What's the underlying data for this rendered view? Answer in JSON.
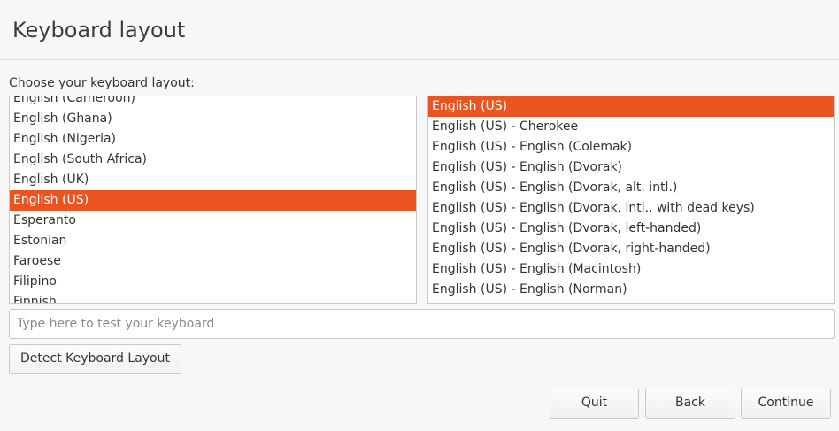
{
  "header": {
    "title": "Keyboard layout"
  },
  "prompt": "Choose your keyboard layout:",
  "layouts": {
    "items": [
      "English (Cameroon)",
      "English (Ghana)",
      "English (Nigeria)",
      "English (South Africa)",
      "English (UK)",
      "English (US)",
      "Esperanto",
      "Estonian",
      "Faroese",
      "Filipino",
      "Finnish"
    ],
    "selected": "English (US)"
  },
  "variants": {
    "items": [
      "English (US)",
      "English (US) - Cherokee",
      "English (US) - English (Colemak)",
      "English (US) - English (Dvorak)",
      "English (US) - English (Dvorak, alt. intl.)",
      "English (US) - English (Dvorak, intl., with dead keys)",
      "English (US) - English (Dvorak, left-handed)",
      "English (US) - English (Dvorak, right-handed)",
      "English (US) - English (Macintosh)",
      "English (US) - English (Norman)"
    ],
    "selected": "English (US)"
  },
  "test_input": {
    "value": "",
    "placeholder": "Type here to test your keyboard"
  },
  "buttons": {
    "detect": "Detect Keyboard Layout",
    "quit": "Quit",
    "back": "Back",
    "continue": "Continue"
  },
  "colors": {
    "accent": "#e95420",
    "background": "#f7f7f7",
    "list_background": "#ffffff"
  }
}
